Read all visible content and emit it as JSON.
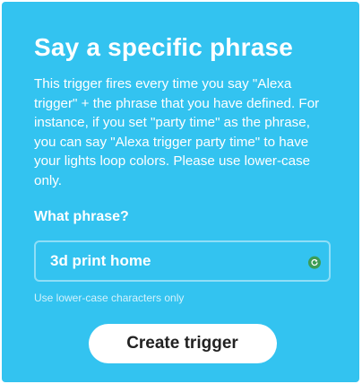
{
  "card": {
    "title": "Say a specific phrase",
    "description": "This trigger fires every time you say \"Alexa trigger\" + the phrase that you have defined. For instance, if you set \"party time\" as the phrase, you can say \"Alexa trigger party time\" to have your lights loop colors. Please use lower-case only.",
    "field_label": "What phrase?",
    "phrase_value": "3d print home",
    "hint": "Use lower-case characters only",
    "create_button": "Create trigger",
    "input_icon": "refresh-icon"
  },
  "colors": {
    "card_background": "#33c3f0",
    "button_background": "#ffffff",
    "button_text": "#222222",
    "icon_badge": "#3c9d55"
  }
}
